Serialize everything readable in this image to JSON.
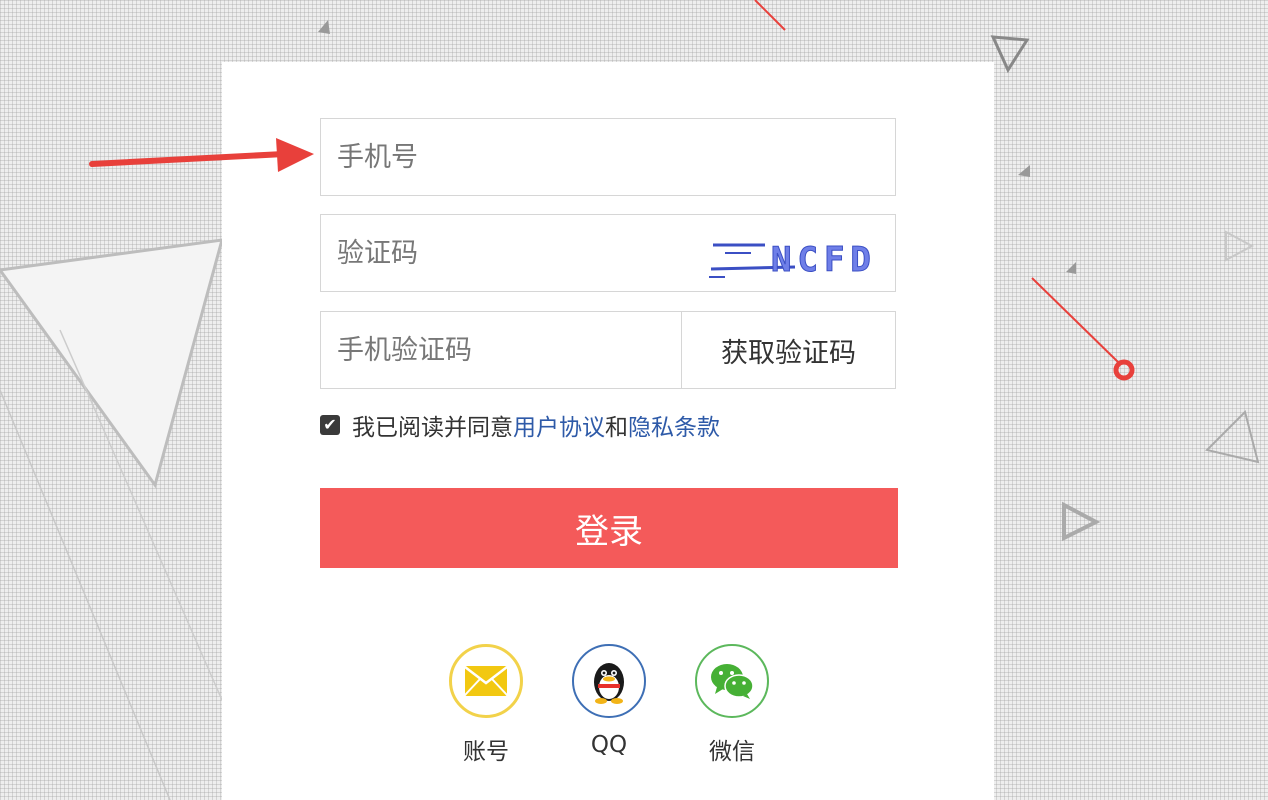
{
  "form": {
    "phone_placeholder": "手机号",
    "captcha_placeholder": "验证码",
    "captcha_text": "NCFD",
    "sms_placeholder": "手机验证码",
    "get_code_label": "获取验证码"
  },
  "agreement": {
    "checked": true,
    "prefix": "我已阅读并同意",
    "user_agreement": "用户协议",
    "conjunction": "和",
    "privacy_policy": "隐私条款"
  },
  "login_label": "登录",
  "social": [
    {
      "label": "账号",
      "icon": "mail-icon",
      "color": "#f2c811"
    },
    {
      "label": "QQ",
      "icon": "qq-penguin-icon",
      "color": "#3e6fb5"
    },
    {
      "label": "微信",
      "icon": "wechat-icon",
      "color": "#4caf50"
    }
  ],
  "colors": {
    "primary": "#f45a5a",
    "link": "#2e5aa8",
    "arrow": "#e8403b"
  }
}
